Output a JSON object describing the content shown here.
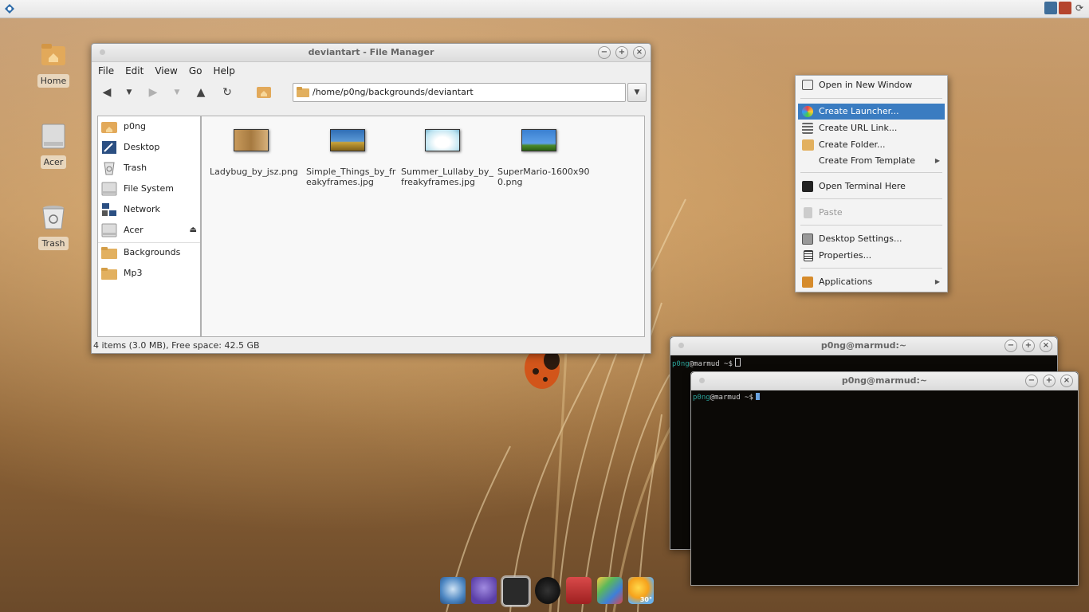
{
  "top_panel": {
    "tray_icons": [
      "network-icon",
      "messaging-icon",
      "refresh-icon"
    ]
  },
  "desktop_icons": [
    {
      "label": "Home",
      "icon": "home-folder-icon"
    },
    {
      "label": "Acer",
      "icon": "drive-icon"
    },
    {
      "label": "Trash",
      "icon": "trash-icon"
    }
  ],
  "file_manager": {
    "title": "deviantart - File Manager",
    "menu": [
      "File",
      "Edit",
      "View",
      "Go",
      "Help"
    ],
    "address": "/home/p0ng/backgrounds/deviantart",
    "sidebar": [
      {
        "label": "p0ng",
        "icon": "home-folder-icon"
      },
      {
        "label": "Desktop",
        "icon": "desktop-icon"
      },
      {
        "label": "Trash",
        "icon": "trash-icon"
      },
      {
        "label": "File System",
        "icon": "drive-icon"
      },
      {
        "label": "Network",
        "icon": "network-icon"
      },
      {
        "label": "Acer",
        "icon": "drive-icon"
      },
      {
        "label": "Backgrounds",
        "icon": "folder-icon"
      },
      {
        "label": "Mp3",
        "icon": "folder-icon"
      }
    ],
    "files": [
      {
        "name": "Ladybug_by_jsz.png"
      },
      {
        "name": "Simple_Things_by_freakyframes.jpg"
      },
      {
        "name": "Summer_Lullaby_by_freakyframes.jpg"
      },
      {
        "name": "SuperMario-1600x900.png"
      }
    ],
    "status": "4 items (3.0 MB), Free space: 42.5 GB"
  },
  "context_menu": {
    "items": [
      {
        "label": "Open in New Window",
        "state": "normal"
      },
      {
        "label": "Create Launcher...",
        "state": "active"
      },
      {
        "label": "Create URL Link...",
        "state": "normal"
      },
      {
        "label": "Create Folder...",
        "state": "normal"
      },
      {
        "label": "Create From Template",
        "state": "normal"
      },
      {
        "label": "Open Terminal Here",
        "state": "normal"
      },
      {
        "label": "Paste",
        "state": "disabled"
      },
      {
        "label": "Desktop Settings...",
        "state": "normal"
      },
      {
        "label": "Properties...",
        "state": "normal"
      },
      {
        "label": "Applications",
        "state": "normal"
      }
    ]
  },
  "terminals": [
    {
      "title": "p0ng@marmud:~",
      "user": "p0ng",
      "host_prompt": "@marmud ~$"
    },
    {
      "title": "p0ng@marmud:~",
      "user": "p0ng",
      "host_prompt": "@marmud ~$"
    }
  ],
  "dock": {
    "items": [
      "browser-icon",
      "pidgin-icon",
      "terminal-icon",
      "amazon-icon",
      "package-manager-icon",
      "paint-icon",
      "weather-icon"
    ],
    "weather_temp": "30°"
  }
}
